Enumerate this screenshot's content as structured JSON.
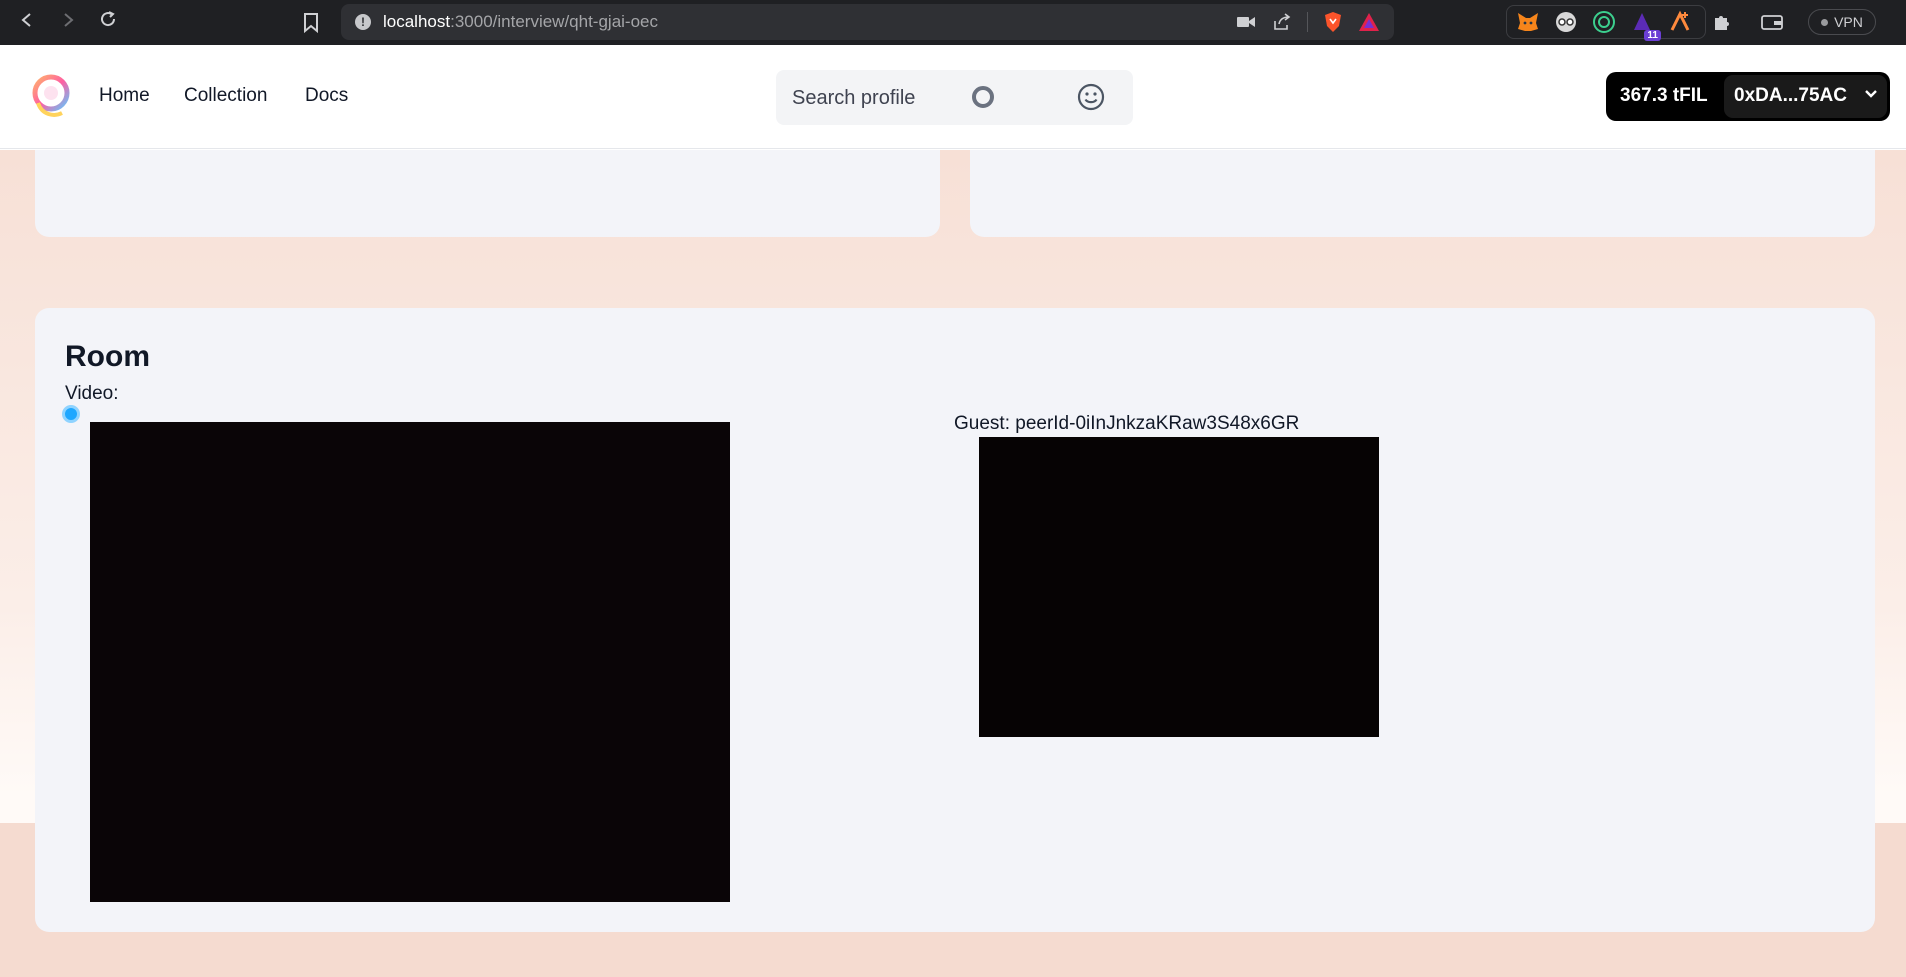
{
  "browser": {
    "url_host": "localhost",
    "url_path": ":3000/interview/qht-gjai-oec",
    "extension_badge": "11",
    "vpn_label": "VPN"
  },
  "header": {
    "nav": [
      "Home",
      "Collection",
      "Docs"
    ],
    "search_placeholder": "Search profile",
    "wallet_balance": "367.3 tFIL",
    "wallet_address": "0xDA...75AC"
  },
  "room": {
    "title": "Room",
    "video_label": "Video:",
    "guest_label": "Guest: peerId-0iInJnkzaKRaw3S48x6GR"
  },
  "colors": {
    "accent_indicator": "#1ea7ff",
    "page_background": "#f7e0d6",
    "card_background": "#f3f4f9",
    "wallet_background": "#000000"
  }
}
